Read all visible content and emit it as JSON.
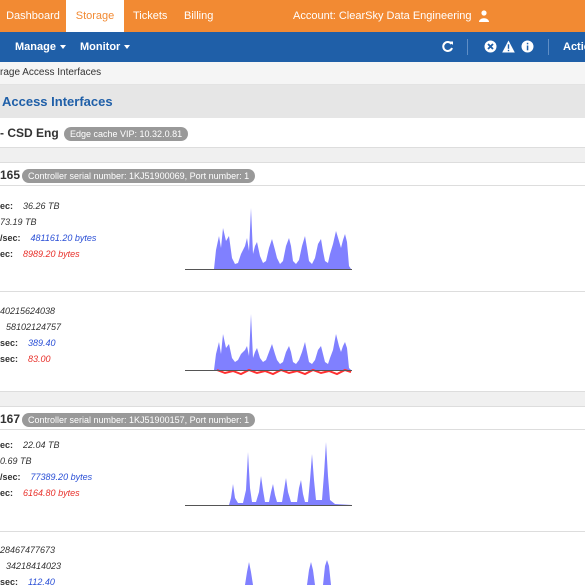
{
  "topbar": {
    "tabs": [
      {
        "label": "Dashboard",
        "active": false
      },
      {
        "label": "Storage",
        "active": true
      },
      {
        "label": "Tickets",
        "active": false
      },
      {
        "label": "Billing",
        "active": false
      }
    ],
    "account": "Account: ClearSky Data Engineering",
    "user_icon": "user-icon"
  },
  "navbar": {
    "manage": "Manage",
    "monitor": "Monitor",
    "icons": [
      "refresh-icon",
      "close-circle-icon",
      "warning-icon",
      "info-icon"
    ],
    "actions": "Actio"
  },
  "breadcrumb": "rage Access Interfaces",
  "page_title": "Access Interfaces",
  "group": {
    "name": "- CSD Eng",
    "vip": "Edge cache VIP: 10.32.0.81"
  },
  "ports": [
    {
      "name": "165",
      "badge": "Controller serial number: 1KJ51900069, Port number: 1",
      "bytes_block": {
        "rows": [
          {
            "label": "ec:",
            "value": "36.26 TB",
            "color": "dark"
          },
          {
            "label": "",
            "value": "73.19 TB",
            "color": "dark"
          },
          {
            "label": "/sec:",
            "value": "481161.20 bytes",
            "color": "blue"
          },
          {
            "label": "ec:",
            "value": "8989.20 bytes",
            "color": "red"
          }
        ]
      },
      "ops_block": {
        "rows": [
          {
            "label": "",
            "value": "40215624038",
            "color": "dark"
          },
          {
            "label": "",
            "value": "58102124757",
            "color": "dark"
          },
          {
            "label": "sec:",
            "value": "389.40",
            "color": "blue"
          },
          {
            "label": "sec:",
            "value": "83.00",
            "color": "red"
          }
        ]
      }
    },
    {
      "name": "167",
      "badge": "Controller serial number: 1KJ51900157, Port number: 1",
      "bytes_block": {
        "rows": [
          {
            "label": "ec:",
            "value": "22.04 TB",
            "color": "dark"
          },
          {
            "label": "",
            "value": "0.69 TB",
            "color": "dark"
          },
          {
            "label": "/sec:",
            "value": "77389.20 bytes",
            "color": "blue"
          },
          {
            "label": "ec:",
            "value": "6164.80 bytes",
            "color": "red"
          }
        ]
      },
      "ops_block": {
        "rows": [
          {
            "label": "",
            "value": "28467477673",
            "color": "dark"
          },
          {
            "label": "",
            "value": "34218414023",
            "color": "dark"
          },
          {
            "label": "sec:",
            "value": "112.40",
            "color": "blue"
          }
        ]
      }
    }
  ],
  "colors": {
    "topbar": "#f28a33",
    "navbar": "#1f5fa8",
    "spark_fill": "#8080ff",
    "spark_red": "#ff3030"
  }
}
